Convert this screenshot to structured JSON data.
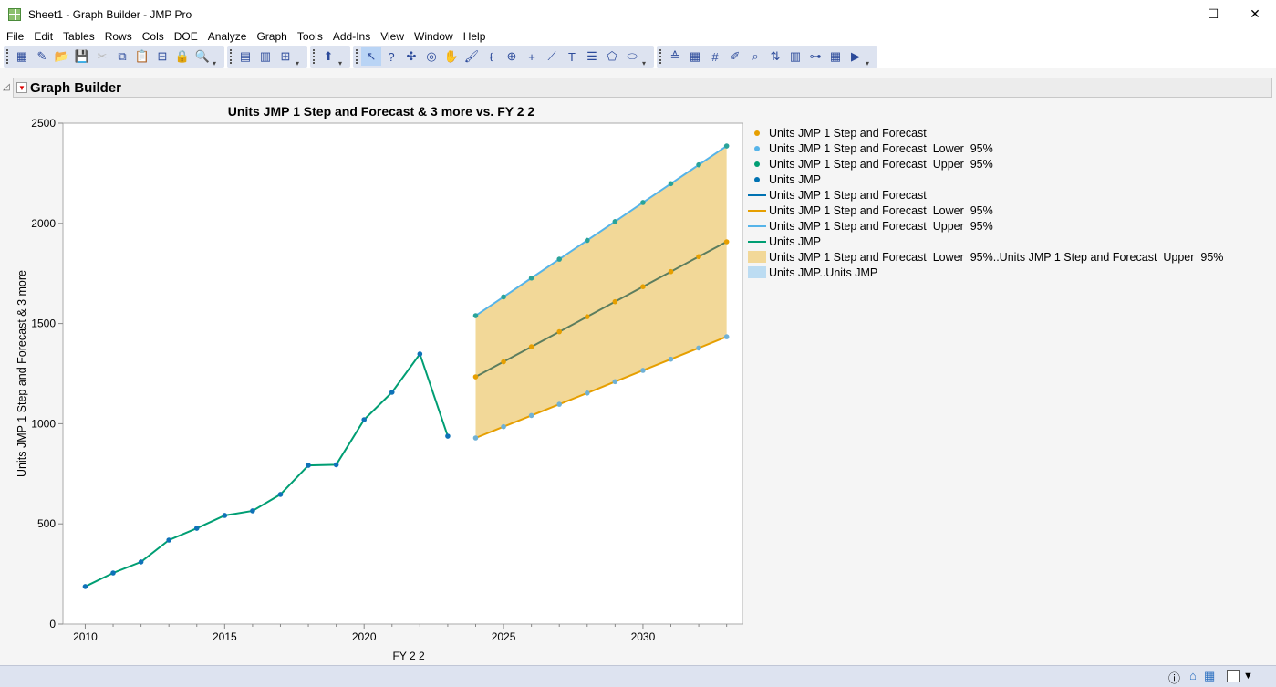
{
  "window": {
    "title": "Sheet1 - Graph Builder - JMP Pro",
    "controls": [
      "—",
      "☐",
      "✕"
    ]
  },
  "menu": [
    "File",
    "Edit",
    "Tables",
    "Rows",
    "Cols",
    "DOE",
    "Analyze",
    "Graph",
    "Tools",
    "Add-Ins",
    "View",
    "Window",
    "Help"
  ],
  "toolbar_groups": [
    [
      [
        "new-data-table-icon",
        "▦"
      ],
      [
        "new-script-icon",
        "✎"
      ],
      [
        "open-folder-icon",
        "📂"
      ],
      [
        "save-icon",
        "💾"
      ],
      [
        "cut-icon",
        "✂",
        1
      ],
      [
        "copy-icon",
        "⧉"
      ],
      [
        "paste-icon",
        "📋"
      ],
      [
        "control-panel-icon",
        "⊟"
      ],
      [
        "lock-icon",
        "🔒",
        1
      ],
      [
        "search-icon",
        "🔍"
      ]
    ],
    [
      [
        "distribution-icon",
        "▤"
      ],
      [
        "columns-icon",
        "▥"
      ],
      [
        "add-graph-icon",
        "⊞"
      ]
    ],
    [
      [
        "script-run-icon",
        "⬆"
      ]
    ],
    [
      [
        "arrow-select-icon",
        "↖",
        0,
        1
      ],
      [
        "help-query-icon",
        "?"
      ],
      [
        "crosshair-icon",
        "✣"
      ],
      [
        "target-icon",
        "◎"
      ],
      [
        "hand-icon",
        "✋"
      ],
      [
        "brush-icon",
        "🖌"
      ],
      [
        "lasso-icon",
        "ℓ"
      ],
      [
        "magnifier-icon",
        "⊕"
      ],
      [
        "plus-icon",
        "+"
      ],
      [
        "ruler-icon",
        "⟋"
      ],
      [
        "text-annotation-icon",
        "T"
      ],
      [
        "line-icon",
        "☰"
      ],
      [
        "polygon-icon",
        "⬠"
      ],
      [
        "oval-icon",
        "⬭"
      ]
    ],
    [
      [
        "align-icon",
        "≙"
      ],
      [
        "data-grid-icon",
        "▦"
      ],
      [
        "number-display-icon",
        "#"
      ],
      [
        "edit-report-icon",
        "✐"
      ],
      [
        "zoom-table-icon",
        "⌕"
      ],
      [
        "sort-icon",
        "⇅"
      ],
      [
        "tree-icon",
        "▥"
      ],
      [
        "dendrogram-icon",
        "⊶"
      ],
      [
        "calculator-icon",
        "▦"
      ],
      [
        "run-script-icon",
        "▶"
      ]
    ]
  ],
  "report": {
    "title": "Graph Builder"
  },
  "chart_data": {
    "type": "line",
    "title": "Units JMP 1 Step and Forecast & 3 more vs. FY 2 2",
    "xlabel": "FY 2 2",
    "ylabel": "Units JMP 1 Step and Forecast & 3 more",
    "xlim": [
      2009.2,
      2033.6
    ],
    "ylim": [
      0,
      2500
    ],
    "xticks": [
      2010,
      2015,
      2020,
      2025,
      2030
    ],
    "yticks": [
      0,
      500,
      1000,
      1500,
      2000,
      2500
    ],
    "actual": {
      "name": "Units JMP",
      "x": [
        2010,
        2011,
        2012,
        2013,
        2014,
        2015,
        2016,
        2017,
        2018,
        2019,
        2020,
        2021,
        2022,
        2023
      ],
      "y": [
        187,
        255,
        310,
        419,
        478,
        542,
        565,
        647,
        792,
        795,
        1020,
        1157,
        1348,
        938
      ]
    },
    "forecast": {
      "x": [
        2024,
        2025,
        2026,
        2027,
        2028,
        2029,
        2030,
        2031,
        2032,
        2033
      ],
      "mid": [
        1234,
        1309,
        1384,
        1459,
        1534,
        1609,
        1684,
        1759,
        1834,
        1908
      ],
      "upper": [
        1539,
        1633,
        1727,
        1821,
        1915,
        2009,
        2104,
        2198,
        2292,
        2386
      ],
      "lower": [
        929,
        985,
        1041,
        1097,
        1153,
        1210,
        1266,
        1322,
        1378,
        1434
      ]
    },
    "colors": {
      "actual_line": "#009e73",
      "actual_point": "#0f72b8",
      "mid_line": "#5c7d5e",
      "mid_point": "#e69f00",
      "upper_line": "#56b4e9",
      "upper_point": "#2aa39a",
      "lower_line": "#e69f00",
      "lower_point": "#6fb1d6",
      "band": "#f2d898"
    },
    "legend": [
      {
        "kind": "dot",
        "color": "#e69f00",
        "label": "Units JMP 1 Step and Forecast"
      },
      {
        "kind": "dot",
        "color": "#56b4e9",
        "label": "Units JMP 1 Step and Forecast  Lower  95%"
      },
      {
        "kind": "dot",
        "color": "#009e73",
        "label": "Units JMP 1 Step and Forecast  Upper  95%"
      },
      {
        "kind": "dot",
        "color": "#0072b2",
        "label": "Units JMP"
      },
      {
        "kind": "line",
        "color": "#0072b2",
        "label": "Units JMP 1 Step and Forecast"
      },
      {
        "kind": "line",
        "color": "#e69f00",
        "label": "Units JMP 1 Step and Forecast  Lower  95%"
      },
      {
        "kind": "line",
        "color": "#56b4e9",
        "label": "Units JMP 1 Step and Forecast  Upper  95%"
      },
      {
        "kind": "line",
        "color": "#009e73",
        "label": "Units JMP"
      },
      {
        "kind": "area",
        "color": "#f2d898",
        "label": "Units JMP 1 Step and Forecast  Lower  95%..Units JMP 1 Step and Forecast  Upper  95%"
      },
      {
        "kind": "area",
        "color": "#bcdcf2",
        "label": "Units JMP..Units JMP"
      }
    ]
  }
}
